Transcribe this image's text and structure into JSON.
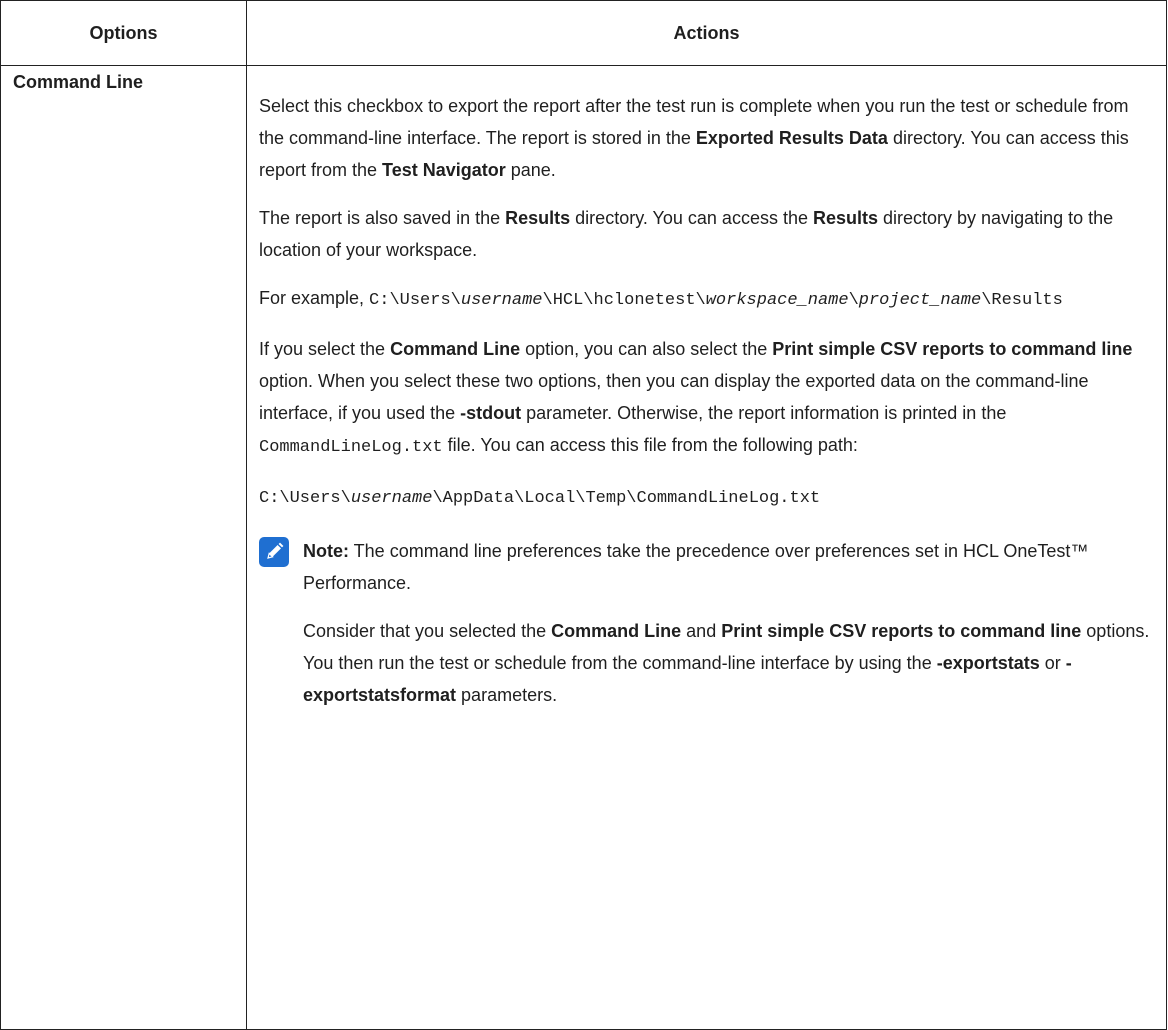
{
  "table": {
    "headers": {
      "options": "Options",
      "actions": "Actions"
    },
    "row": {
      "option": "Command Line",
      "p1": {
        "t1": "Select this checkbox to export the report after the test run is complete when you run the test or schedule from the command-line interface. The report is stored in the ",
        "b1": "Exported Results Data",
        "t2": " directory. You can access this report from the ",
        "b2": "Test Navigator",
        "t3": " pane."
      },
      "p2": {
        "t1": "The report is also saved in the ",
        "b1": "Results",
        "t2": " directory. You can access the ",
        "b2": "Results",
        "t3": " directory by navigating to the location of your workspace."
      },
      "p3": {
        "t1": "For example, ",
        "c1": "C:\\Users\\",
        "i1": "username",
        "c2": "\\HCL\\hclonetest\\",
        "i2": "workspace_name",
        "c3": "\\",
        "i3": "project_name",
        "c4": "\\Results"
      },
      "p4": {
        "t1": "If you select the ",
        "b1": "Command Line",
        "t2": " option, you can also select the ",
        "b2": "Print simple CSV reports to command line",
        "t3": " option. When you select these two options, then you can display the exported data on the command-line interface, if you used the ",
        "b3": "-stdout",
        "t4": " parameter. Otherwise, the report information is printed in the ",
        "c1": "CommandLineLog.txt",
        "t5": " file. You can access this file from the following path:"
      },
      "p5": {
        "c1": "C:\\Users\\",
        "i1": "username",
        "c2": "\\AppData\\Local\\Temp\\CommandLineLog.txt"
      },
      "note": {
        "icon": "pencil-icon",
        "label": "Note:",
        "t1": " The command line preferences take the precedence over preferences set in HCL OneTest™ Performance.",
        "p2": {
          "t1": "Consider that you selected the ",
          "b1": "Command Line",
          "t2": " and ",
          "b2": "Print simple CSV reports to command line",
          "t3": " options. You then run the test or schedule from the command-line interface by using the ",
          "b3": "-exportstats",
          "t4": " or ",
          "b4": "-exportstatsformat",
          "t5": " parameters."
        }
      }
    }
  },
  "colors": {
    "note_icon": "#1f6fd1",
    "border": "#222222"
  }
}
